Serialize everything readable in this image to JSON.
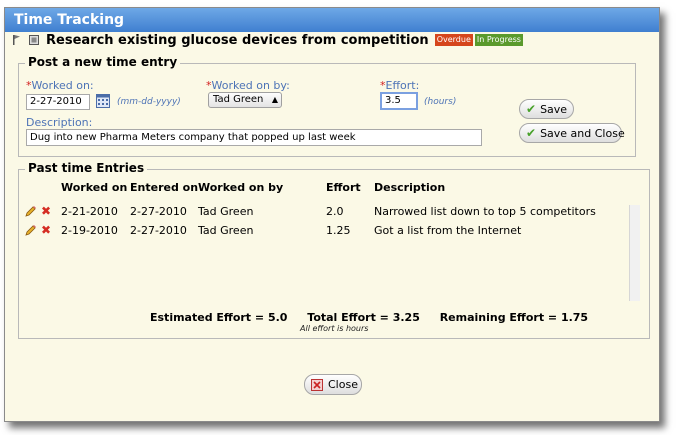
{
  "dialog": {
    "title": "Time Tracking"
  },
  "task": {
    "title": "Research existing glucose devices from competition",
    "badges": {
      "overdue": "Overdue",
      "in_progress": "In Progress"
    }
  },
  "new_entry": {
    "legend": "Post a new time entry",
    "worked_on": {
      "label": "Worked on:",
      "value": "2-27-2010",
      "hint": "(mm-dd-yyyy)"
    },
    "worked_on_by": {
      "label": "Worked on by:",
      "value": "Tad Green"
    },
    "effort": {
      "label": "Effort:",
      "value": "3.5",
      "hint": "(hours)"
    },
    "description": {
      "label": "Description:",
      "value": "Dug into new Pharma Meters company that popped up last week"
    },
    "save_label": "Save",
    "save_close_label": "Save and Close"
  },
  "past_entries": {
    "legend": "Past time Entries",
    "columns": [
      "Worked on",
      "Entered on",
      "Worked on by",
      "Effort",
      "Description"
    ],
    "rows": [
      {
        "worked_on": "2-21-2010",
        "entered_on": "2-27-2010",
        "by": "Tad Green",
        "effort": "2.0",
        "description": "Narrowed list down to top 5 competitors"
      },
      {
        "worked_on": "2-19-2010",
        "entered_on": "2-27-2010",
        "by": "Tad Green",
        "effort": "1.25",
        "description": "Got a list from the Internet"
      }
    ],
    "summary": {
      "estimated": "Estimated Effort = 5.0",
      "total": "Total Effort = 3.25",
      "remaining": "Remaining Effort = 1.75"
    },
    "note": "All effort is hours"
  },
  "close_label": "Close"
}
